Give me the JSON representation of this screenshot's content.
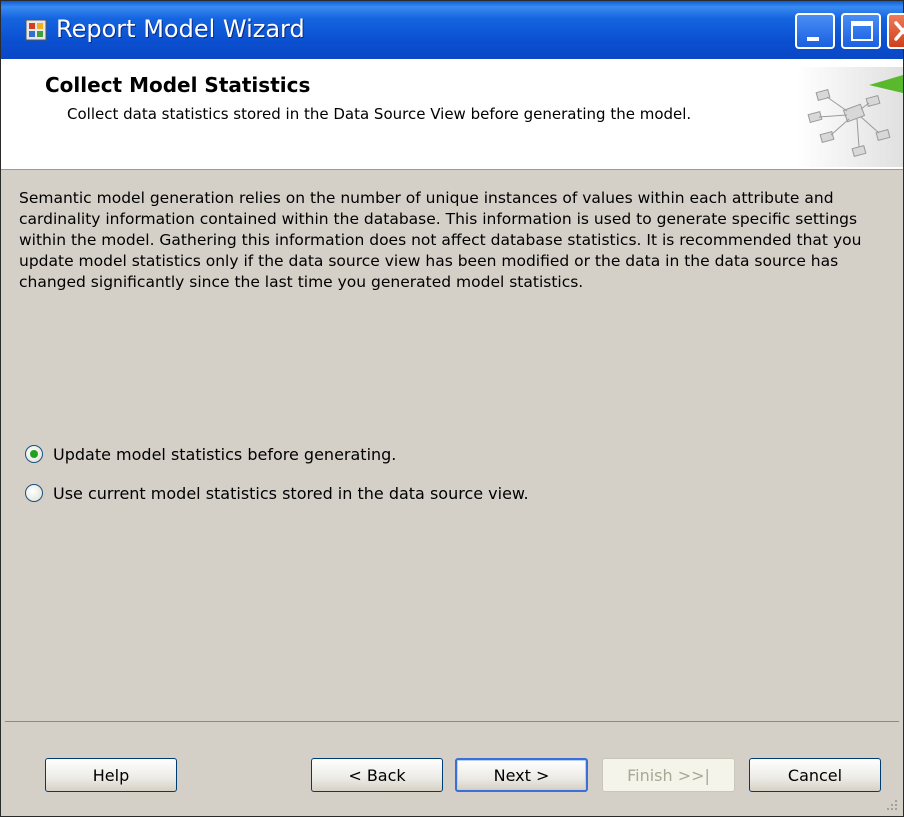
{
  "window": {
    "title": "Report Model Wizard",
    "icon": "wizard-app-icon",
    "controls": [
      "minimize-icon",
      "maximize-icon",
      "close-icon"
    ]
  },
  "header": {
    "title": "Collect Model Statistics",
    "description": "Collect data statistics stored in the Data Source View before generating the model."
  },
  "body": {
    "paragraph": "Semantic model generation relies on the number of unique instances of values within each attribute and cardinality information contained within the database. This information is used to generate specific settings within the model. Gathering this information does not affect database statistics. It is recommended that you update model statistics only if the data source view has been modified or the data in the data source has changed significantly since the last time you generated model statistics."
  },
  "options": [
    {
      "label": "Update model statistics before generating.",
      "selected": true
    },
    {
      "label": "Use current model statistics stored in the data source view.",
      "selected": false
    }
  ],
  "buttons": {
    "help": "Help",
    "back": "< Back",
    "next": "Next >",
    "finish": "Finish >>|",
    "cancel": "Cancel"
  },
  "colors": {
    "titlebar": "#0a4fd0",
    "dialog_bg": "#d4d0c8",
    "radio_selected": "#21a121",
    "close_button": "#d0401a"
  }
}
